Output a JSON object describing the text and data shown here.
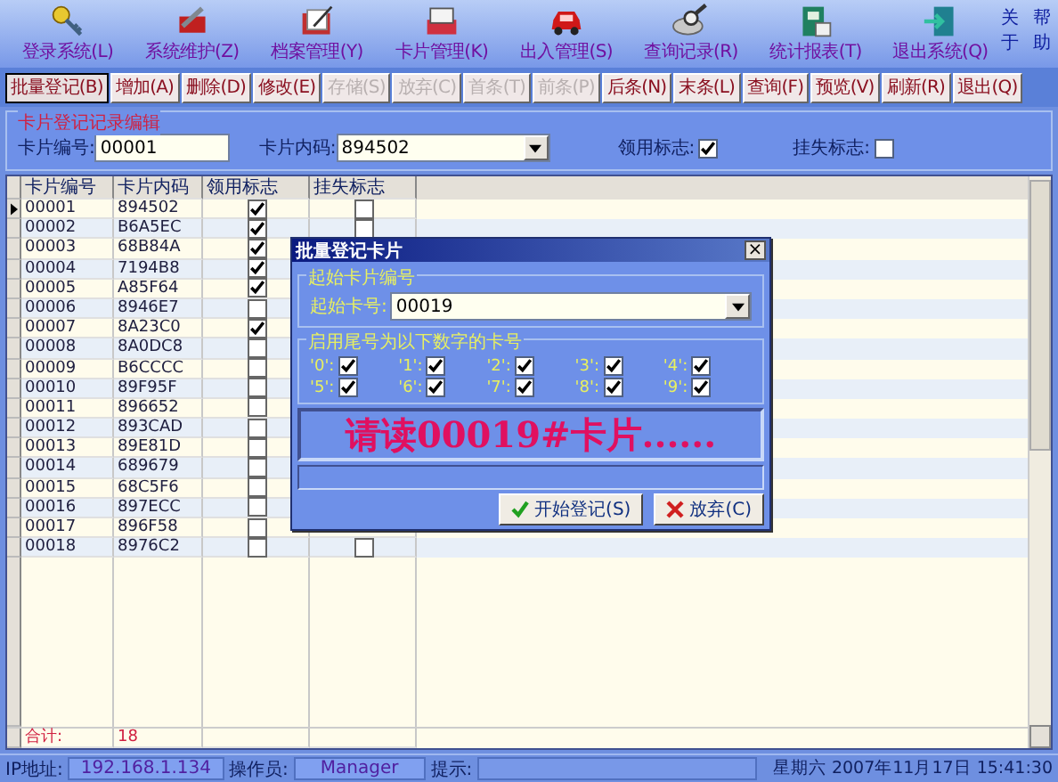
{
  "menu": [
    {
      "label": "登录系统(L)"
    },
    {
      "label": "系统维护(Z)"
    },
    {
      "label": "档案管理(Y)"
    },
    {
      "label": "卡片管理(K)"
    },
    {
      "label": "出入管理(S)"
    },
    {
      "label": "查询记录(R)"
    },
    {
      "label": "统计报表(T)"
    },
    {
      "label": "退出系统(Q)"
    }
  ],
  "help_links": [
    "关于",
    "帮助"
  ],
  "toolbar": [
    {
      "label": "批量登记(B)",
      "disabled": false,
      "selected": true
    },
    {
      "label": "增加(A)",
      "disabled": false,
      "selected": false
    },
    {
      "label": "删除(D)",
      "disabled": false,
      "selected": false
    },
    {
      "label": "修改(E)",
      "disabled": false,
      "selected": false
    },
    {
      "label": "存储(S)",
      "disabled": true,
      "selected": false
    },
    {
      "label": "放弃(C)",
      "disabled": true,
      "selected": false
    },
    {
      "label": "首条(T)",
      "disabled": true,
      "selected": false
    },
    {
      "label": "前条(P)",
      "disabled": true,
      "selected": false
    },
    {
      "label": "后条(N)",
      "disabled": false,
      "selected": false
    },
    {
      "label": "末条(L)",
      "disabled": false,
      "selected": false
    },
    {
      "label": "查询(F)",
      "disabled": false,
      "selected": false
    },
    {
      "label": "预览(V)",
      "disabled": false,
      "selected": false
    },
    {
      "label": "刷新(R)",
      "disabled": false,
      "selected": false
    },
    {
      "label": "退出(Q)",
      "disabled": false,
      "selected": false
    }
  ],
  "edit_group": {
    "title": "卡片登记记录编辑",
    "card_no_label": "卡片编号:",
    "card_no": "00001",
    "inner_code_label": "卡片内码:",
    "inner_code": "894502",
    "used_label": "领用标志:",
    "used": true,
    "lost_label": "挂失标志:",
    "lost": false
  },
  "table": {
    "columns": [
      "卡片编号",
      "卡片内码",
      "领用标志",
      "挂失标志"
    ],
    "rows": [
      {
        "no": "00001",
        "code": "894502",
        "used": true,
        "lost": false,
        "selected": true
      },
      {
        "no": "00002",
        "code": "B6A5EC",
        "used": true,
        "lost": false,
        "selected": false
      },
      {
        "no": "00003",
        "code": "68B84A",
        "used": true,
        "selected": false
      },
      {
        "no": "00004",
        "code": "7194B8",
        "used": true,
        "selected": false
      },
      {
        "no": "00005",
        "code": "A85F64",
        "used": true,
        "selected": false
      },
      {
        "no": "00006",
        "code": "8946E7",
        "used": false,
        "selected": false
      },
      {
        "no": "00007",
        "code": "8A23C0",
        "used": true,
        "selected": false
      },
      {
        "no": "00008",
        "code": "8A0DC8",
        "used": false,
        "selected": false
      },
      {
        "no": "00009",
        "code": "B6CCCC",
        "used": false,
        "selected": false
      },
      {
        "no": "00010",
        "code": "89F95F",
        "used": false,
        "selected": false
      },
      {
        "no": "00011",
        "code": "896652",
        "used": false,
        "selected": false
      },
      {
        "no": "00012",
        "code": "893CAD",
        "used": false,
        "selected": false
      },
      {
        "no": "00013",
        "code": "89E81D",
        "used": false,
        "selected": false
      },
      {
        "no": "00014",
        "code": "689679",
        "used": false,
        "selected": false
      },
      {
        "no": "00015",
        "code": "68C5F6",
        "used": false,
        "selected": false
      },
      {
        "no": "00016",
        "code": "897ECC",
        "used": false,
        "selected": false
      },
      {
        "no": "00017",
        "code": "896F58",
        "used": false,
        "selected": false
      },
      {
        "no": "00018",
        "code": "8976C2",
        "used": false,
        "lost": false,
        "selected": false
      }
    ],
    "total_label": "合计:",
    "total": "18"
  },
  "dialog": {
    "title": "批量登记卡片",
    "close": "×",
    "start_group": "起始卡片编号",
    "start_label": "起始卡号:",
    "start_value": "00019",
    "digits_group": "启用尾号为以下数字的卡号",
    "digits": [
      {
        "label": "'0':",
        "checked": true
      },
      {
        "label": "'1':",
        "checked": true
      },
      {
        "label": "'2':",
        "checked": true
      },
      {
        "label": "'3':",
        "checked": true
      },
      {
        "label": "'4':",
        "checked": true
      },
      {
        "label": "'5':",
        "checked": true
      },
      {
        "label": "'6':",
        "checked": true
      },
      {
        "label": "'7':",
        "checked": true
      },
      {
        "label": "'8':",
        "checked": true
      },
      {
        "label": "'9':",
        "checked": true
      }
    ],
    "message": "请读00019#卡片......",
    "buttons": [
      {
        "label": "开始登记(S)",
        "kind": "ok"
      },
      {
        "label": "放弃(C)",
        "kind": "cancel"
      }
    ]
  },
  "status_bar": {
    "ip_label": "IP地址:",
    "ip": "192.168.1.134",
    "operator_label": "操作员:",
    "operator": "Manager",
    "hint_label": "提示:",
    "datetime": "星期六 2007年11月17日 15:41:30"
  }
}
